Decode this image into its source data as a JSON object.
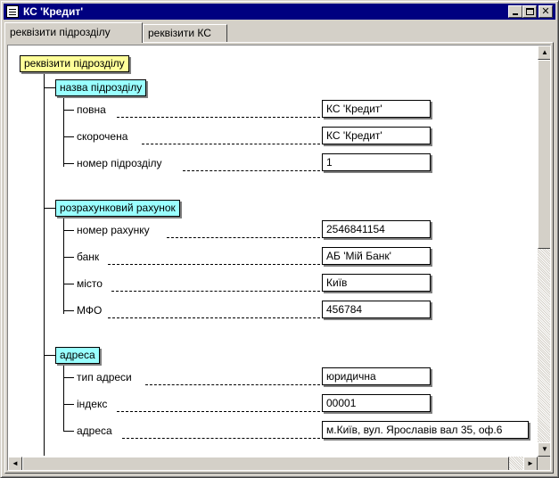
{
  "window": {
    "title": "КС 'Кредит'",
    "icons": {
      "app": "document-icon",
      "minimize": "minimize-icon",
      "maximize": "maximize-icon",
      "close": "close-icon"
    }
  },
  "tabs": [
    {
      "label": "реквізити підрозділу",
      "active": true
    },
    {
      "label": "реквізити КС",
      "active": false
    }
  ],
  "tree": {
    "root": "реквізити підрозділу",
    "groups": [
      {
        "label": "назва підрозділу",
        "fields": [
          {
            "label": "повна",
            "value": "КС 'Кредит'"
          },
          {
            "label": "скорочена",
            "value": "КС 'Кредит'"
          },
          {
            "label": "номер підрозділу",
            "value": "1"
          }
        ]
      },
      {
        "label": "розрахунковий рахунок",
        "fields": [
          {
            "label": "номер рахунку",
            "value": "2546841154"
          },
          {
            "label": "банк",
            "value": "АБ 'Мій Банк'"
          },
          {
            "label": "місто",
            "value": "Київ"
          },
          {
            "label": "МФО",
            "value": "456784"
          }
        ]
      },
      {
        "label": "адреса",
        "fields": [
          {
            "label": "тип адреси",
            "value": "юридична"
          },
          {
            "label": "індекс",
            "value": "00001"
          },
          {
            "label": "адреса",
            "value": "м.Київ, вул. Ярославів вал 35, оф.6"
          }
        ]
      }
    ]
  },
  "scrollbars": {
    "up": "▲",
    "down": "▼",
    "left": "◄",
    "right": "►",
    "vertical_position": 0,
    "horizontal_position": 0
  }
}
